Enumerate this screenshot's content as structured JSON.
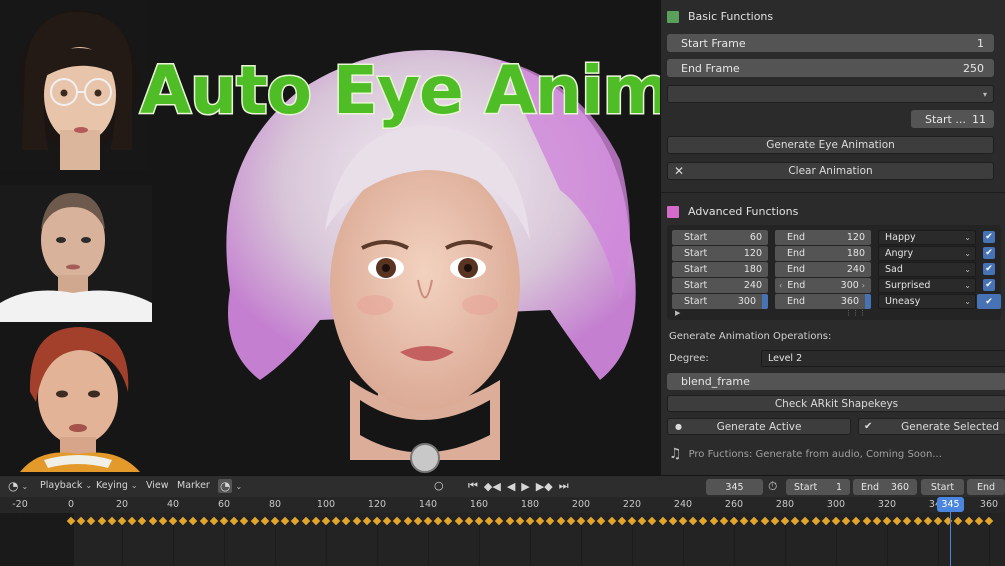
{
  "overlay_title": "Auto Eye Animator",
  "basic": {
    "header": "Basic Functions",
    "start_frame_label": "Start Frame",
    "start_frame_value": "1",
    "end_frame_label": "End Frame",
    "end_frame_value": "250",
    "start_short_label": "Start ...",
    "start_short_value": "11",
    "generate_label": "Generate Eye Animation",
    "clear_label": "Clear Animation"
  },
  "advanced": {
    "header": "Advanced Functions",
    "rows": [
      {
        "start_label": "Start",
        "start": "60",
        "end_label": "End",
        "end": "120",
        "emotion": "Happy",
        "checked": true
      },
      {
        "start_label": "Start",
        "start": "120",
        "end_label": "End",
        "end": "180",
        "emotion": "Angry",
        "checked": true
      },
      {
        "start_label": "Start",
        "start": "180",
        "end_label": "End",
        "end": "240",
        "emotion": "Sad",
        "checked": true
      },
      {
        "start_label": "Start",
        "start": "240",
        "end_label": "End",
        "end": "300",
        "emotion": "Surprised",
        "checked": true
      },
      {
        "start_label": "Start",
        "start": "300",
        "end_label": "End",
        "end": "360",
        "emotion": "Uneasy",
        "checked": true
      }
    ],
    "operations_label": "Generate Animation Operations:",
    "degree_label": "Degree:",
    "degree_value": "Level 2",
    "blend_frame": "blend_frame",
    "check_arkit": "Check ARkit Shapekeys",
    "generate_active": "Generate Active",
    "generate_selected": "Generate Selected",
    "pro_text": "Pro Fuctions: Generate from audio, Coming Soon..."
  },
  "timeline": {
    "menus": [
      "Playback",
      "Keying",
      "View",
      "Marker"
    ],
    "current_frame": "345",
    "start_label": "Start",
    "start_value": "1",
    "end_label": "End",
    "end_value": "360",
    "btn_start": "Start",
    "btn_end": "End",
    "ticks": [
      "-20",
      "0",
      "20",
      "40",
      "60",
      "80",
      "100",
      "120",
      "140",
      "160",
      "180",
      "200",
      "220",
      "240",
      "260",
      "280",
      "300",
      "320",
      "340",
      "360"
    ],
    "playhead_label": "345"
  },
  "colors": {
    "basic_square": "#5aa05a",
    "advanced_square": "#d46ac9",
    "checkbox": "#4772b3",
    "playhead": "#4a86e0",
    "keyframe": "#e3a62a",
    "title_green": "#4fbe26"
  }
}
